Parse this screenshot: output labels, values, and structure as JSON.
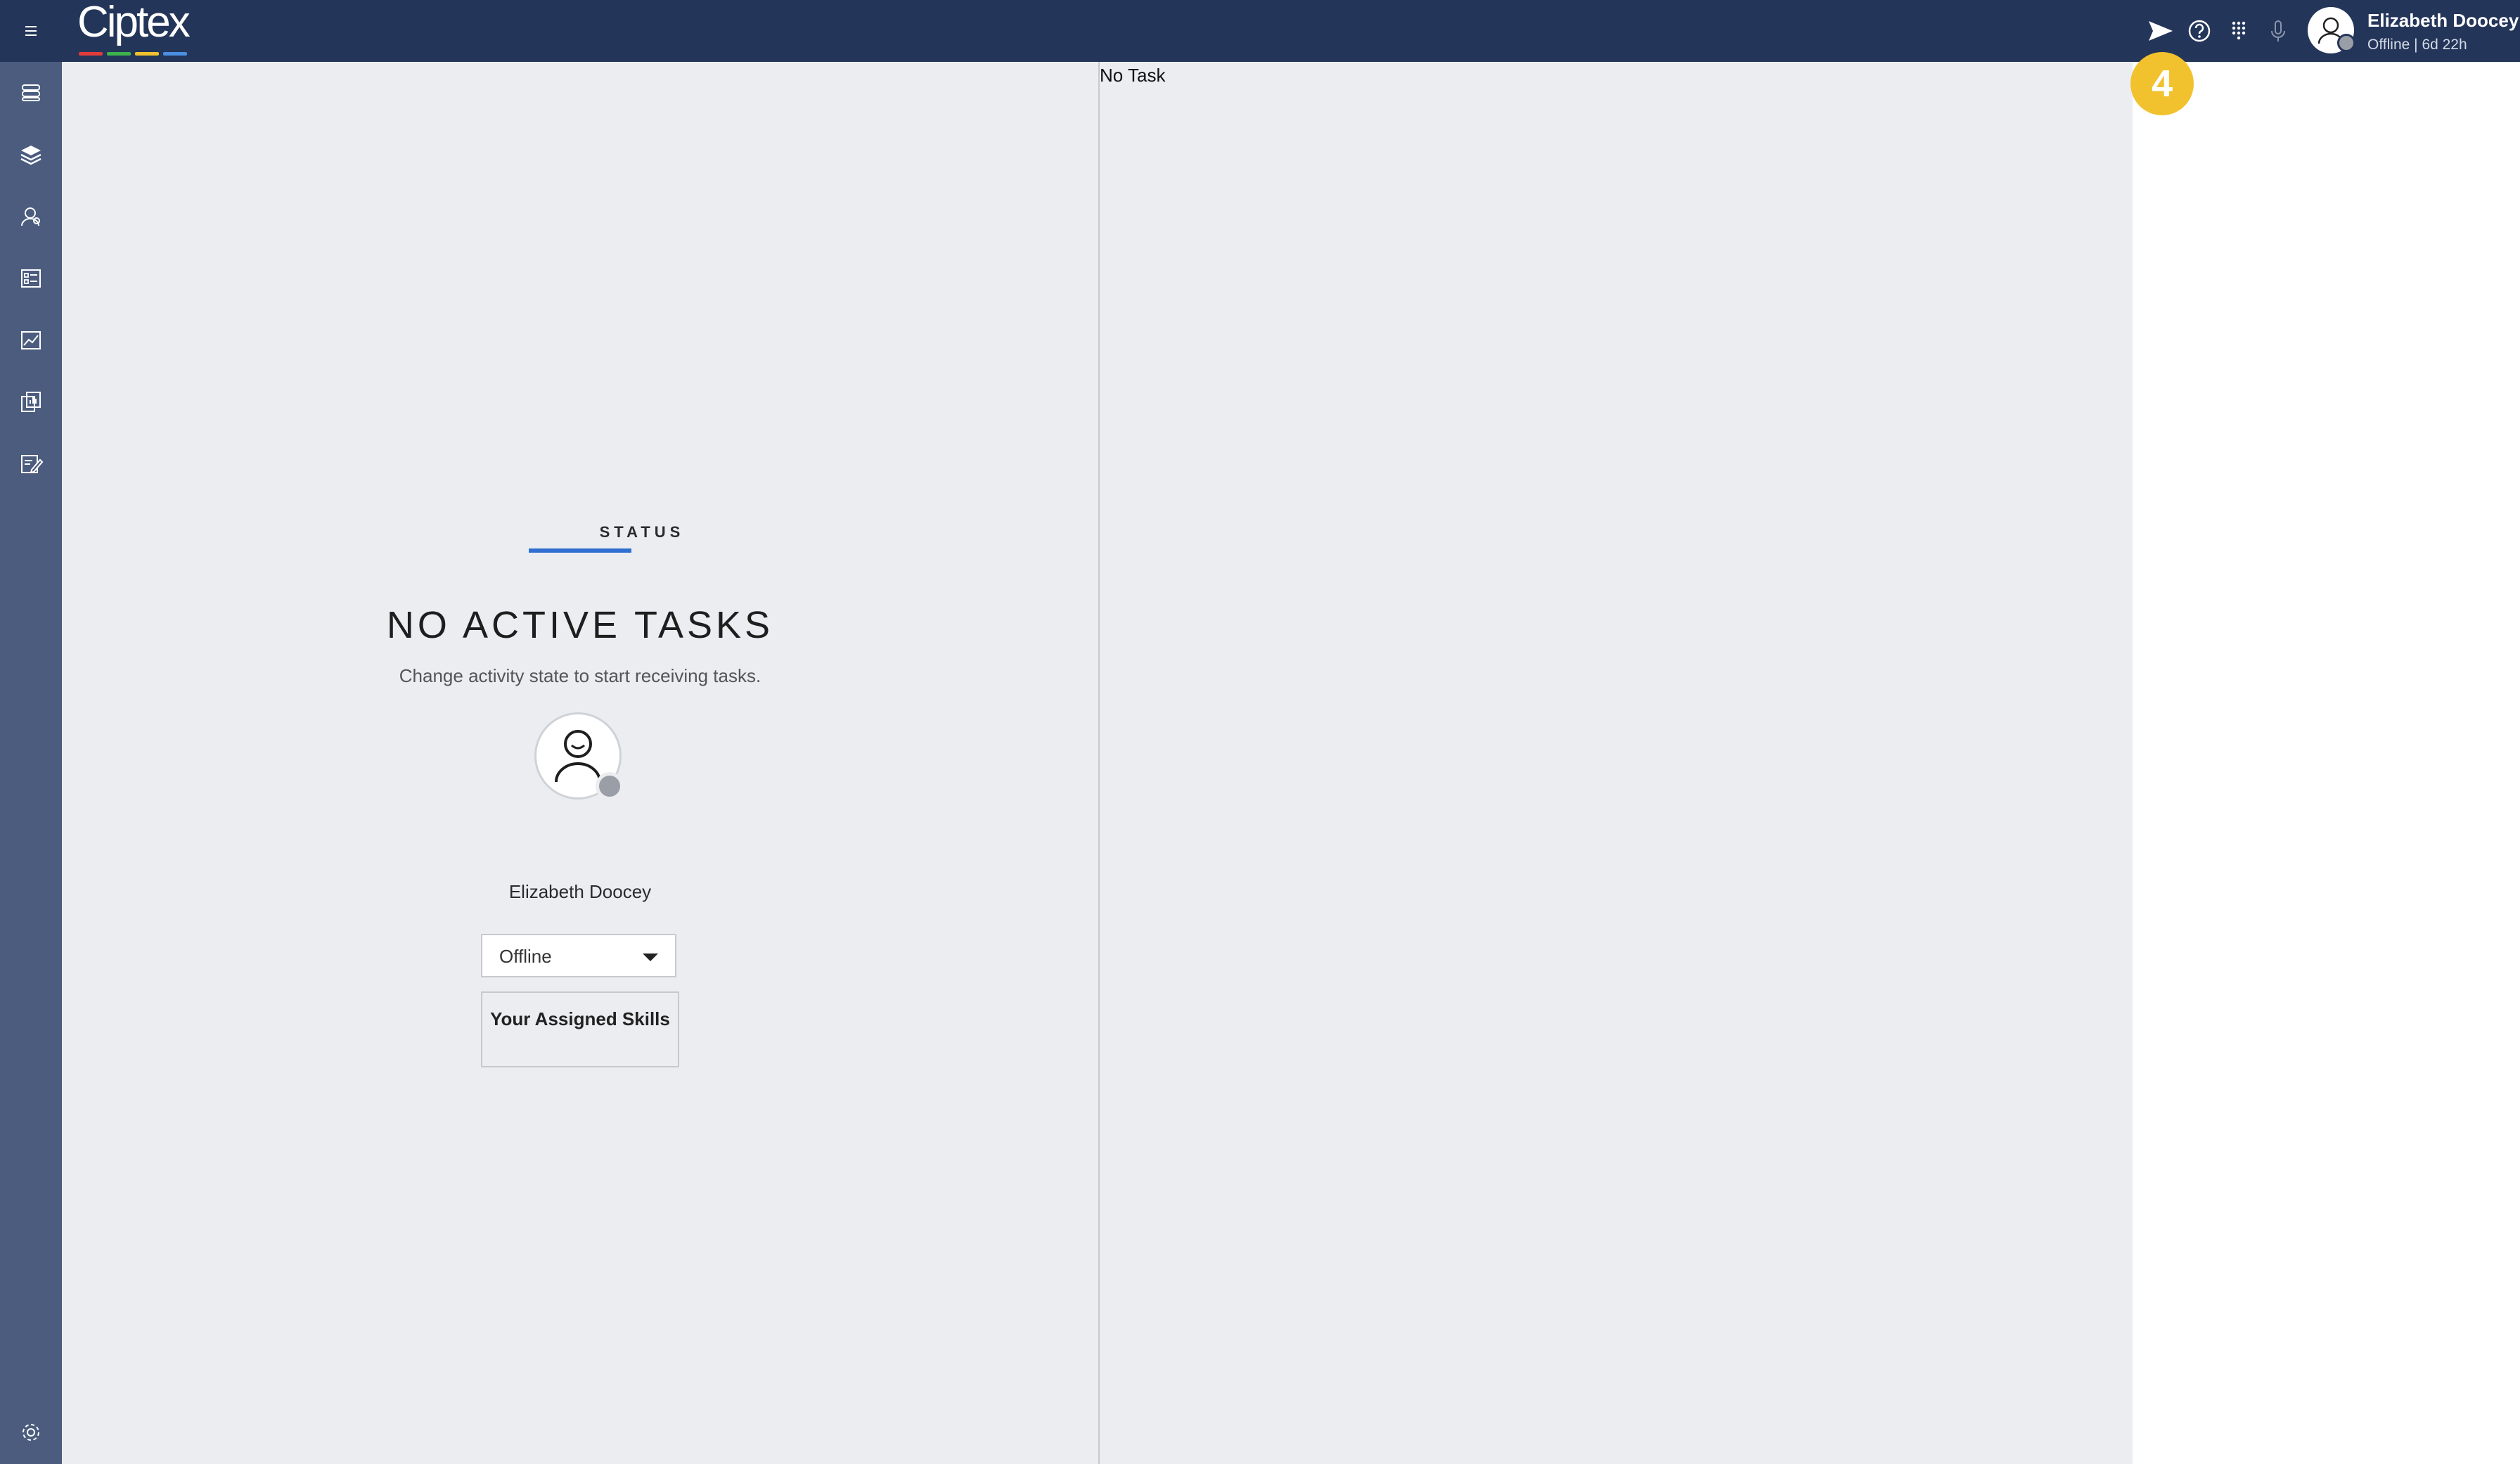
{
  "header": {
    "logo_text": "Ciptex",
    "logo_colors": [
      "#e23b3b",
      "#3cb44b",
      "#f2c12e",
      "#4a8fe2"
    ],
    "user_name": "Elizabeth Doocey",
    "user_status": "Offline | 6d 22h"
  },
  "sidebar": {
    "items": [
      "layers-stack-icon",
      "layers-icon",
      "agents-icon",
      "queues-icon",
      "analytics-icon",
      "reports-icon",
      "edit-icon"
    ],
    "bottom": "settings-gear-icon"
  },
  "status_panel": {
    "heading": "STATUS",
    "title": "NO ACTIVE TASKS",
    "subtitle": "Change activity state to start receiving tasks.",
    "agent_name": "Elizabeth Doocey",
    "activity_value": "Offline",
    "skills_title": "Your Assigned Skills"
  },
  "task_panel": {
    "empty_label": "No Task"
  },
  "step_badge": "4",
  "colors": {
    "topbar": "#24355a",
    "sidebar": "#4b5c7e",
    "accent": "#2f6fd1",
    "badge": "#f2c12e"
  }
}
